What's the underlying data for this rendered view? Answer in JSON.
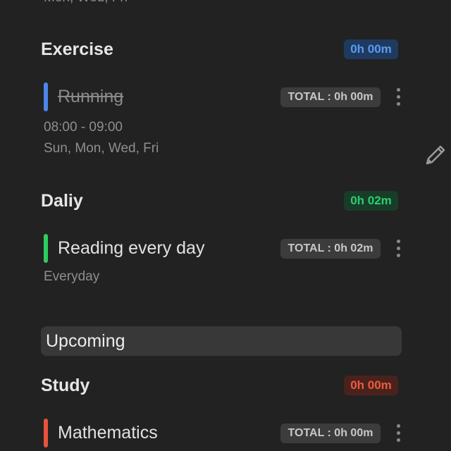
{
  "cut_off_text": "Mon, Wed, Fri",
  "sections": [
    {
      "title": "Exercise",
      "badge": "0h 00m",
      "badge_color": "#3b82f6",
      "tasks": [
        {
          "title": "Running",
          "completed": true,
          "bar_color": "#4c86e8",
          "total": "TOTAL : 0h 00m",
          "time": "08:00 - 09:00",
          "days": "Sun, Mon, Wed, Fri"
        }
      ]
    },
    {
      "title": "Daliy",
      "badge": "0h 02m",
      "badge_color": "#22c55e",
      "tasks": [
        {
          "title": "Reading every day",
          "completed": false,
          "bar_color": "#2ecc5f",
          "total": "TOTAL : 0h 02m",
          "days": "Everyday"
        }
      ]
    }
  ],
  "upcoming_label": "Upcoming",
  "upcoming_sections": [
    {
      "title": "Study",
      "badge": "0h 00m",
      "badge_color": "#e8533a",
      "tasks": [
        {
          "title": "Mathematics",
          "bar_color": "#e8533a",
          "total": "TOTAL : 0h 00m"
        }
      ]
    }
  ],
  "icons": {
    "menu": "vertical-dots-icon",
    "edit": "pencil-icon"
  }
}
